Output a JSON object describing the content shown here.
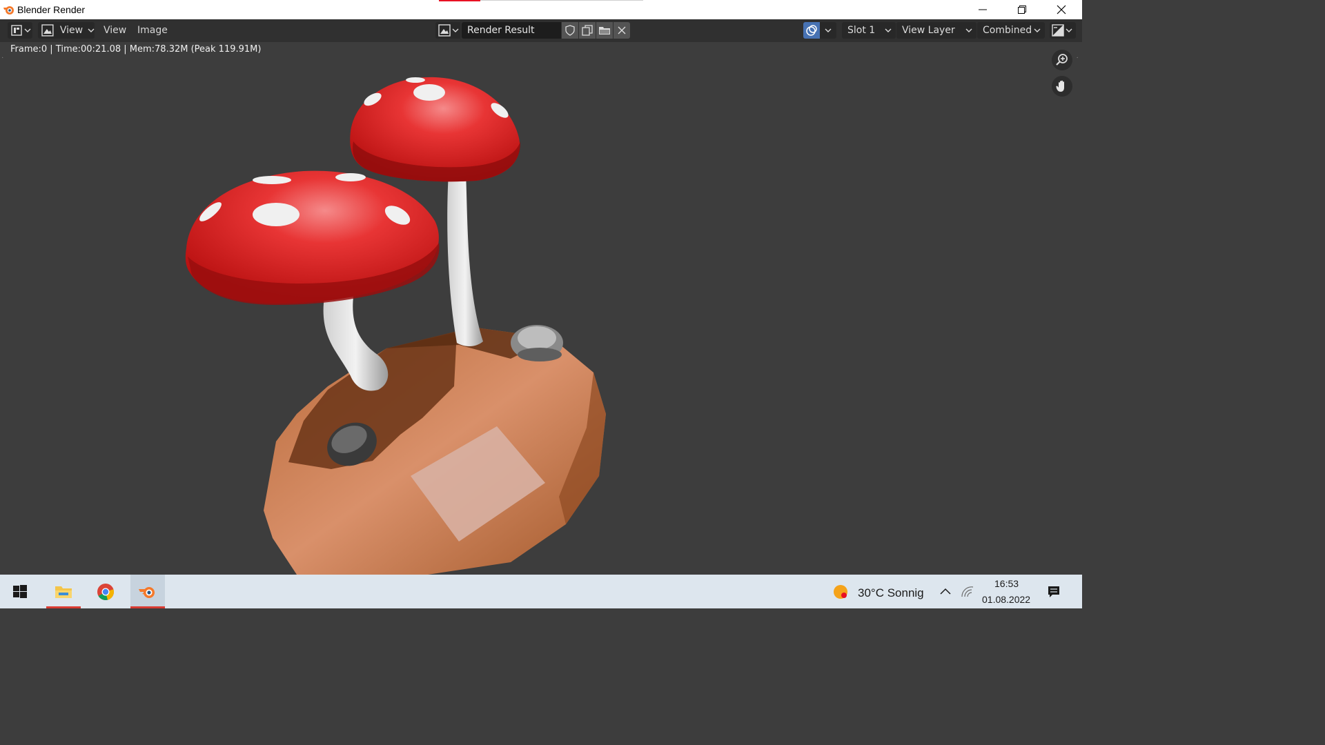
{
  "window": {
    "title": "Blender Render",
    "controls": [
      "minimize",
      "restore",
      "close"
    ]
  },
  "header": {
    "editor_type_icon": "image-editor-icon",
    "view_mode_label": "View",
    "menus": [
      "View",
      "Image"
    ],
    "image_name": "Render Result",
    "slot": "Slot 1",
    "view_layer": "View Layer",
    "pass": "Combined"
  },
  "status_line": "Frame:0 | Time:00:21.08 | Mem:78.32M (Peak 119.91M)",
  "viewport": {
    "background": "#3d3d3d",
    "render_subject": "two red mushrooms with white spots on a brown low-poly rock with two small grey stones",
    "nav_tools": [
      "zoom-icon",
      "pan-hand-icon"
    ]
  },
  "taskbar": {
    "apps": [
      "start-icon",
      "file-explorer-icon",
      "chrome-icon",
      "blender-icon"
    ],
    "weather": "30°C Sonnig",
    "time": "16:53",
    "date": "01.08.2022"
  },
  "colors": {
    "accent_active": "#4772b3",
    "taskbar": "#dde6ee",
    "indicator": "#d83b32"
  }
}
